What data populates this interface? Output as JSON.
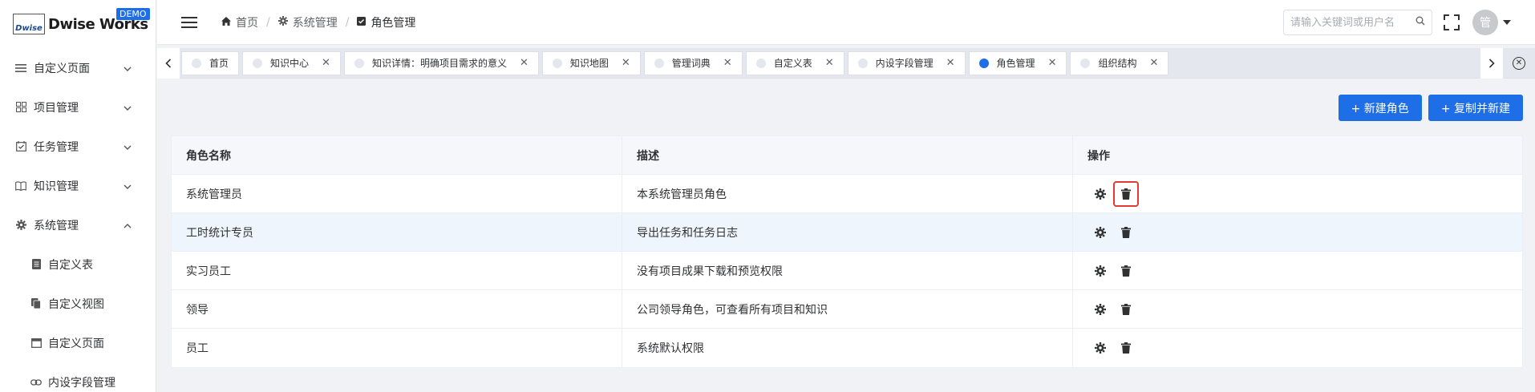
{
  "brand": {
    "logo_mark": "Dwise",
    "name": "Dwise Works",
    "badge": "DEMO"
  },
  "sidebar": {
    "items": [
      {
        "label": "自定义页面",
        "icon": "list-icon",
        "expanded": false
      },
      {
        "label": "项目管理",
        "icon": "grid-icon",
        "expanded": false
      },
      {
        "label": "任务管理",
        "icon": "calendar-check-icon",
        "expanded": false
      },
      {
        "label": "知识管理",
        "icon": "book-icon",
        "expanded": false
      },
      {
        "label": "系统管理",
        "icon": "gear-icon",
        "expanded": true
      }
    ],
    "subitems": [
      {
        "label": "自定义表",
        "icon": "file-icon"
      },
      {
        "label": "自定义视图",
        "icon": "copy-icon"
      },
      {
        "label": "自定义页面",
        "icon": "window-icon"
      },
      {
        "label": "内设字段管理",
        "icon": "link-icon"
      }
    ]
  },
  "header": {
    "breadcrumb": [
      "首页",
      "系统管理",
      "角色管理"
    ],
    "search_placeholder": "请输入关键词或用户名",
    "avatar_text": "管"
  },
  "tabs": [
    {
      "label": "首页",
      "closable": false,
      "active": false
    },
    {
      "label": "知识中心",
      "closable": true,
      "active": false
    },
    {
      "label": "知识详情：明确项目需求的意义",
      "closable": true,
      "active": false
    },
    {
      "label": "知识地图",
      "closable": true,
      "active": false
    },
    {
      "label": "管理词典",
      "closable": true,
      "active": false
    },
    {
      "label": "自定义表",
      "closable": true,
      "active": false
    },
    {
      "label": "内设字段管理",
      "closable": true,
      "active": false
    },
    {
      "label": "角色管理",
      "closable": true,
      "active": true
    },
    {
      "label": "组织结构",
      "closable": true,
      "active": false
    }
  ],
  "toolbar": {
    "new_role": "+ 新建角色",
    "copy_new": "+ 复制并新建"
  },
  "table": {
    "columns": [
      "角色名称",
      "描述",
      "操作"
    ],
    "rows": [
      {
        "name": "系统管理员",
        "desc": "本系统管理员角色"
      },
      {
        "name": "工时统计专员",
        "desc": "导出任务和任务日志"
      },
      {
        "name": "实习员工",
        "desc": "没有项目成果下载和预览权限"
      },
      {
        "name": "领导",
        "desc": "公司领导角色，可查看所有项目和知识"
      },
      {
        "name": "员工",
        "desc": "系统默认权限"
      }
    ]
  },
  "colors": {
    "primary": "#1e6ee8",
    "highlight": "#e53935"
  }
}
